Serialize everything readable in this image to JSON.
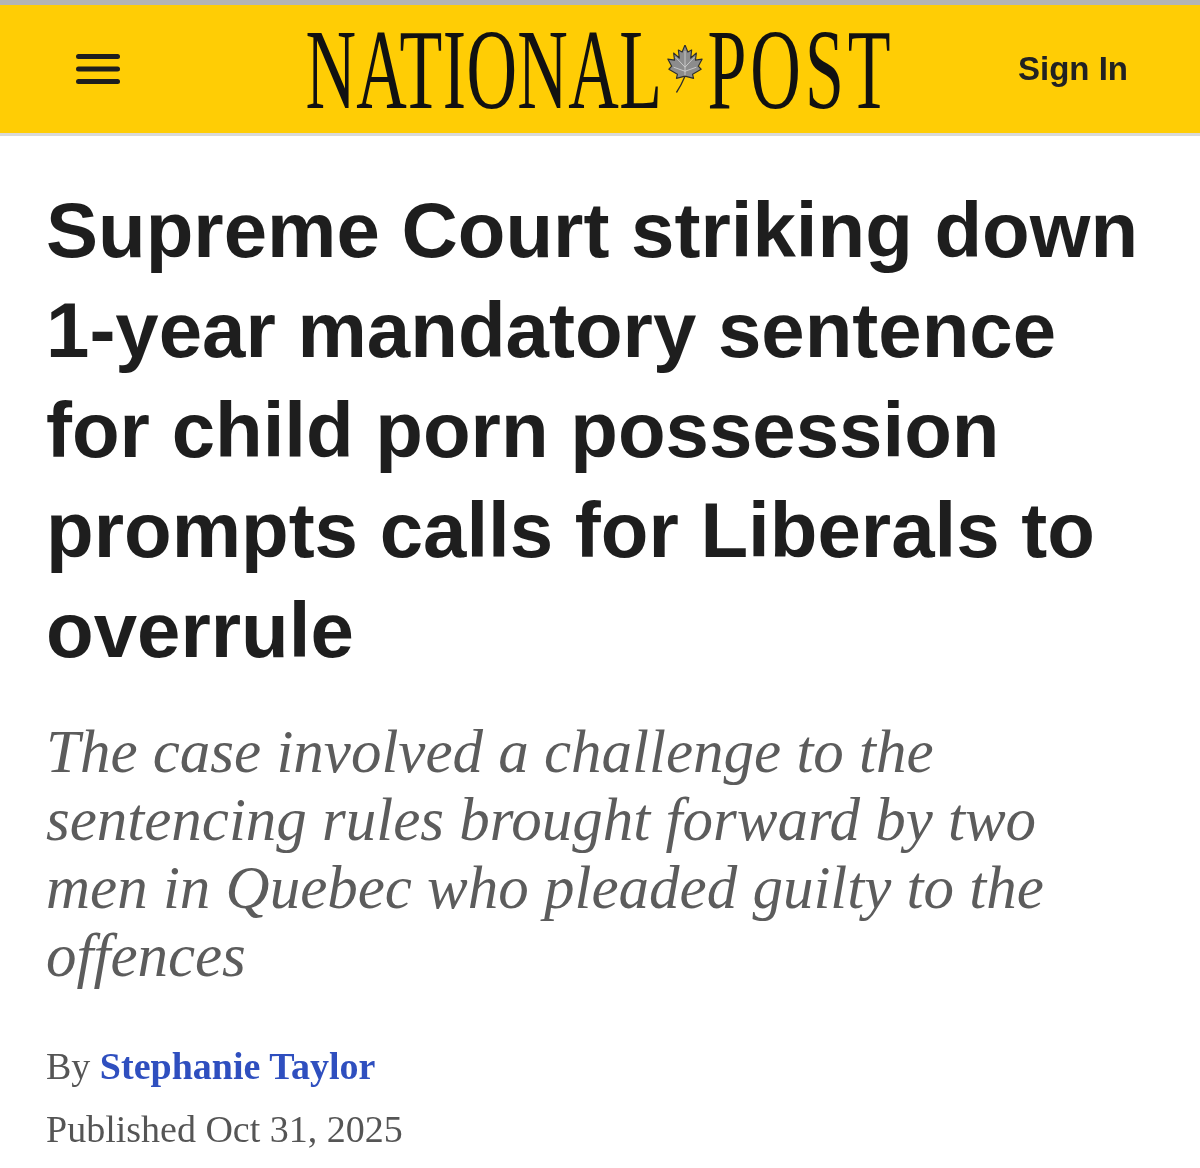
{
  "header": {
    "logo": [
      "NATIONAL",
      "POST"
    ],
    "sign_in": "Sign In"
  },
  "article": {
    "headline": "Supreme Court striking down 1-year mandatory sentence for child porn possession prompts calls for Liberals to overrule",
    "deck": "The case involved a challenge to the sentencing rules brought forward by two men in Quebec who pleaded guilty to the offences",
    "byline": {
      "prefix": "By",
      "author": "Stephanie Taylor"
    },
    "published": "Published Oct 31, 2025"
  }
}
